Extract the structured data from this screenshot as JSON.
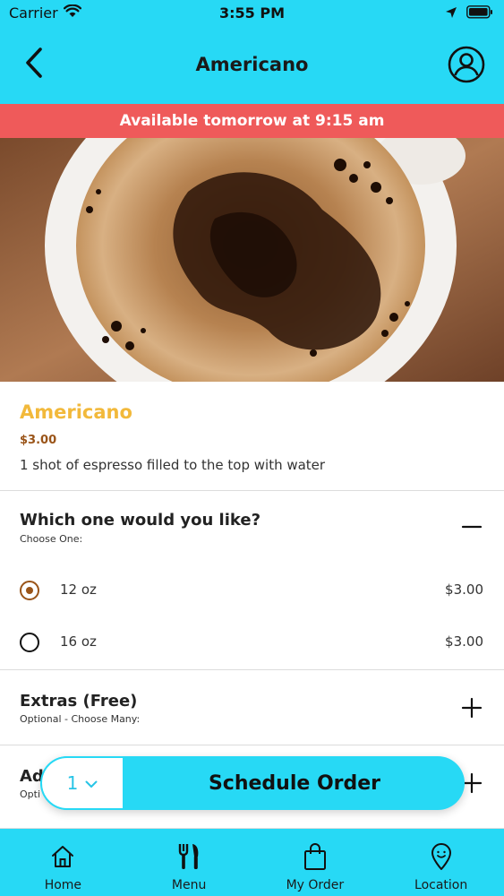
{
  "status_bar": {
    "carrier": "Carrier",
    "time": "3:55 PM",
    "icons": [
      "wifi-icon",
      "location-arrow-icon",
      "battery-icon"
    ]
  },
  "nav": {
    "title": "Americano",
    "back_icon": "chevron-left-icon",
    "profile_icon": "user-circle-icon"
  },
  "banner": {
    "text": "Available tomorrow at 9:15 am"
  },
  "product": {
    "name": "Americano",
    "price": "$3.00",
    "description": "1 shot of espresso filled to the top with water"
  },
  "sections": [
    {
      "title": "Which one would you like?",
      "subtitle": "Choose One:",
      "expanded": true,
      "toggle_icon": "minus-icon",
      "options": [
        {
          "label": "12 oz",
          "price": "$3.00",
          "selected": true
        },
        {
          "label": "16 oz",
          "price": "$3.00",
          "selected": false
        }
      ]
    },
    {
      "title": "Extras (Free)",
      "subtitle": "Optional - Choose Many:",
      "expanded": false,
      "toggle_icon": "plus-icon"
    },
    {
      "title": "Ad",
      "subtitle": "Opti",
      "expanded": false,
      "toggle_icon": "plus-icon"
    }
  ],
  "order_bar": {
    "quantity": "1",
    "button_label": "Schedule Order"
  },
  "tabbar": {
    "items": [
      {
        "label": "Home",
        "icon": "home-icon"
      },
      {
        "label": "Menu",
        "icon": "fork-knife-icon"
      },
      {
        "label": "My Order",
        "icon": "shopping-bag-icon"
      },
      {
        "label": "Location",
        "icon": "map-pin-icon"
      }
    ]
  },
  "colors": {
    "primary": "#27d9f5",
    "banner": "#ef5a5a",
    "product_name": "#f2b93b",
    "accent_brown": "#9a5418"
  }
}
